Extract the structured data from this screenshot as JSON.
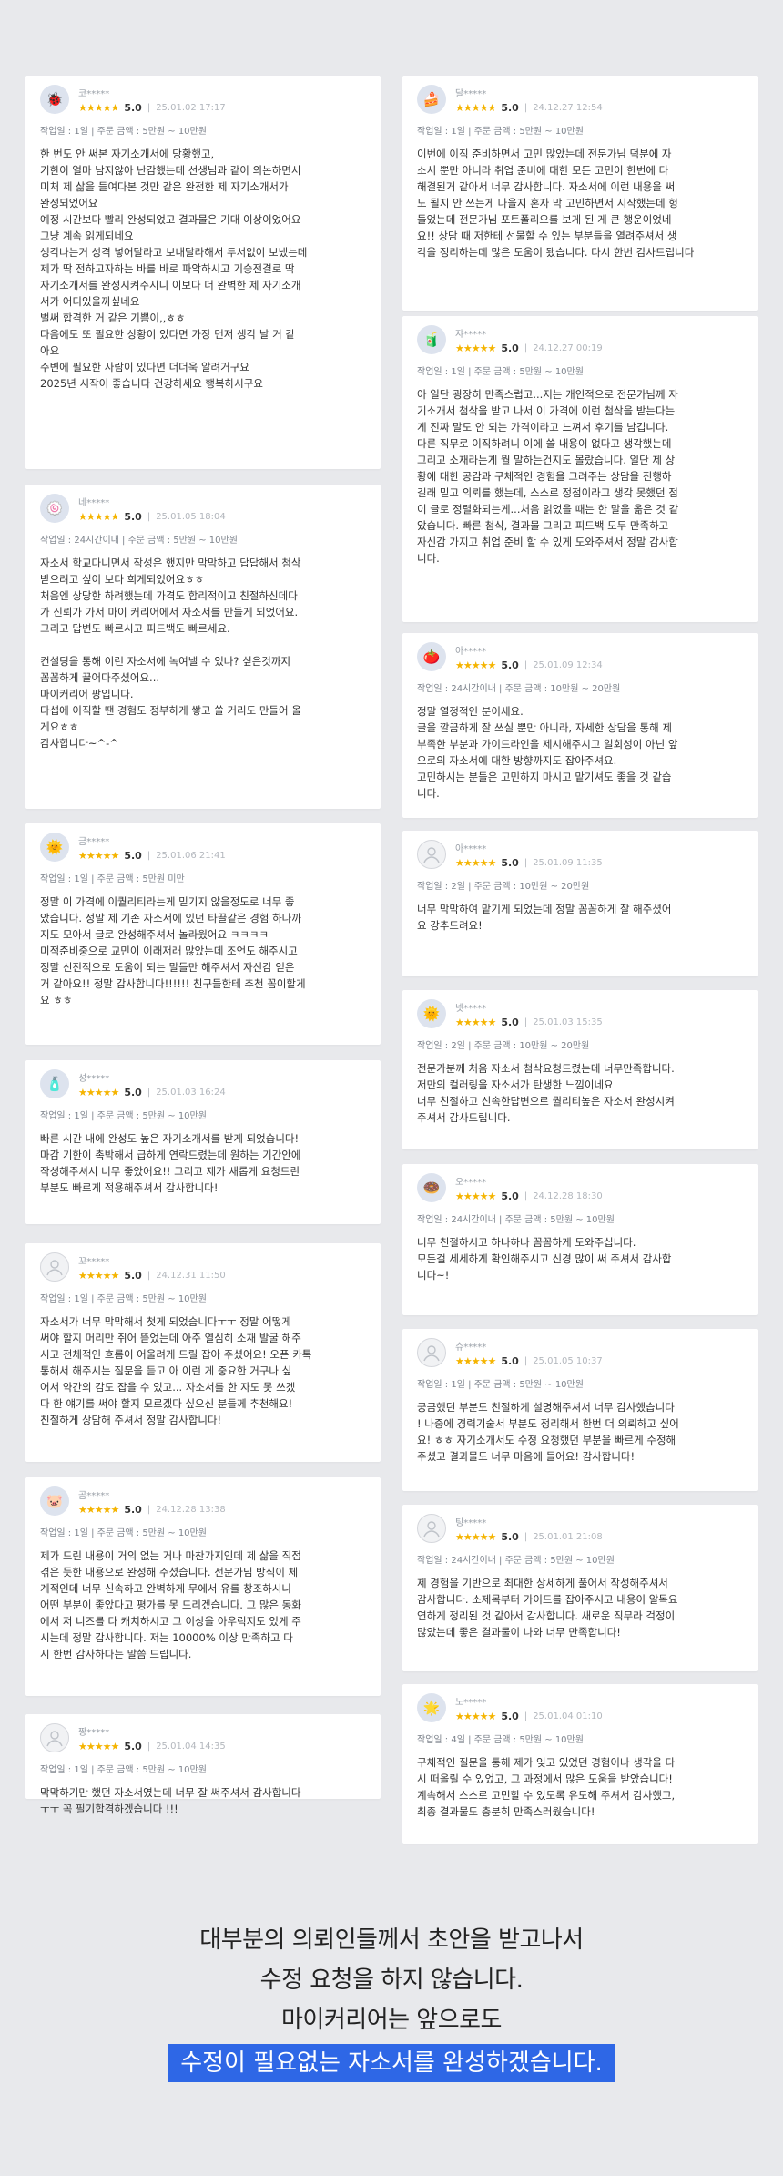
{
  "reviews_left": [
    {
      "avatar": "🐞",
      "name": "코*****",
      "score": "5.0",
      "date": "25.01.02 17:17",
      "tags": "작업일 : 1일 | 주문 금액 : 5만원 ~ 10만원",
      "text": "한 번도 안 써본 자기소개서에 당황했고,\n기한이 얼마 남지않아 난감했는데 선생님과 같이 의논하면서\n 미처 제 삶을 들여다본 것만 같은 완전한 제 자기소개서가\n완성되었어요\n예정 시간보다 빨리 완성되었고 결과물은 기대 이상이었어요\n그냥 계속 읽게되네요\n생각나는거 성격 넣어달라고 보내달라해서 두서없이 보냈는데\n제가 딱 전하고자하는 바를 바로 파악하시고 기승전결로 딱\n자기소개서를 완성시켜주시니 이보다 더 완벽한 제 자기소개\n서가 어디있을까싶네요\n벌써 합격한 거 같은 기쁨이,,ㅎㅎ\n다음에도 또 필요한 상황이 있다면 가장 먼저 생각 날 거 같\n아요\n주변에 필요한 사람이 있다면 더더욱 알려거구요\n2025년 시작이 좋습니다 건강하세요 행복하시구요"
    },
    {
      "avatar": "🍥",
      "name": "네*****",
      "score": "5.0",
      "date": "25.01.05 18:04",
      "tags": "작업일 : 24시간이내 | 주문 금액 : 5만원 ~ 10만원",
      "text": "자소서 학교다니면서 작성은 했지만 막막하고 답답해서 첨삭\n받으려고 싶이 보다 희게되었어요ㅎㅎ\n처음엔 상당한 하려했는데 가격도 합리적이고 친절하신데다\n가 신뢰가 가서 마이 커리어에서 자소서를 만들게 되었어요.\n그리고 답변도 빠르시고 피드백도 빠르세요.\n\n컨설팅을 통해 이런 자소서에 녹여낼 수 있나? 싶은것까지\n꼼꼼하게 끌어다주셨어요...\n마이커리어 팡입니다.\n다섭에 이직할 땐 경험도 정부하게 쌓고 쓸 거리도 만들어 올\n게요ㅎㅎ\n감사합니다~^-^"
    },
    {
      "avatar": "🌞",
      "name": "금*****",
      "score": "5.0",
      "date": "25.01.06 21:41",
      "tags": "작업일 : 1일 | 주문 금액 : 5만원 미만",
      "text": "정말 이 가격에 이퀄리티라는게 믿기지 않을정도로 너무 좋\n았습니다. 정말 제 기존 자소서에 있던 타끌같은 경험 하나까\n지도 모아서 글로 완성해주셔서 놀라웠어요 ㅋㅋㅋㅋ\n미적준비중으로 교민이 이래저래 많았는데 조언도 해주시고\n정말 신진적으로 도움이 되는 말들만 해주셔서 자신감 얻은\n거 같아요!! 정말 감사합니다!!!!!! 친구들한테 추천 꼼이할게\n요 ㅎㅎ"
    },
    {
      "avatar": "🧴",
      "name": "성*****",
      "score": "5.0",
      "date": "25.01.03 16:24",
      "tags": "작업일 : 1일 | 주문 금액 : 5만원 ~ 10만원",
      "text": "빠른 시간 내에 완성도 높은 자기소개서를 받게 되었습니다!\n마감 기한이 촉박해서 급하게 연락드렸는데 원하는 기간안에\n 작성해주셔서 너무 좋았어요!! 그리고 제가 새롭게 요청드린\n 부분도 빠르게 적용해주셔서 감사합니다!"
    },
    {
      "avatar": "",
      "name": "꼬*****",
      "score": "5.0",
      "date": "24.12.31 11:50",
      "tags": "작업일 : 1일 | 주문 금액 : 5만원 ~ 10만원",
      "text": "자소서가 너무 막막해서 첫게 되었습니다ㅜㅜ 정말 어떻게\n써야 할지 머리만 쥐어 뜯었는데 아주 열심히 소재 발굴 해주\n시고 전체적인 흐름이 어울려게 드릴 잡아 주셨어요! 오픈 카톡\n통해서 해주시는 질문을 듣고 아 이런 게 중요한 거구나 싶\n어서 약간의 감도 잡을 수 있고... 자소서를 한 자도 못 쓰겠\n다 한 얘기를 써야 할지 모르겠다 싶으신 분들께 추천해요!\n친절하게 상담해 주셔서 정말 감사합니다!"
    },
    {
      "avatar": "🐷",
      "name": "곰*****",
      "score": "5.0",
      "date": "24.12.28 13:38",
      "tags": "작업일 : 1일 | 주문 금액 : 5만원 ~ 10만원",
      "text": "제가 드린 내용이 거의 없는 거나 마찬가지인데 제 삶을 직접\n 겪은 듯한 내용으로 완성해 주셨습니다. 전문가님 방식이 체\n계적인데 너무 신속하고 완벽하게 무에서 유를 창조하시니\n어떤 부분이 좋았다고 평가를 못 드리겠습니다. 그 많은 동화\n에서 저 니즈를 다 캐치하시고 그 이상을 아우릭지도 있게 주\n시는데 정말 감사합니다. 저는 10000% 이상 만족하고 다\n시 한번 감사하다는 말씀 드립니다."
    },
    {
      "avatar": "",
      "name": "짱*****",
      "score": "5.0",
      "date": "25.01.04 14:35",
      "tags": "작업일 : 1일 | 주문 금액 : 5만원 ~ 10만원",
      "text": "막막하기만 했던 자소서였는데 너무 잘 써주셔서 감사합니다\nㅜㅜ 꼭 필기합격하겠습니다 !!!"
    }
  ],
  "reviews_right": [
    {
      "avatar": "🍰",
      "name": "달*****",
      "score": "5.0",
      "date": "24.12.27 12:54",
      "tags": "작업일 : 1일 | 주문 금액 : 5만원 ~ 10만원",
      "text": "이번에 이직 준비하면서 고민 많았는데 전문가님 덕분에 자\n소서 뿐만 아니라 취업 준비에 대한 모든 고민이 한번에 다\n해결된거 같아서 너무 감사합니다. 자소서에 이런 내용을 써\n도 될지 안 쓰는게 나을지 혼자 막 고민하면서 시작했는데 헝\n들었는데 전문가님 포트폴리오를 보게 된 게 큰 행운이었네\n요!! 상담 때 저한테 선물할 수 있는 부분들을 열려주셔서 생\n각을 정리하는데 많은 도움이 됐습니다. 다시 한번 감사드립니다"
    },
    {
      "avatar": "🧃",
      "name": "쟈*****",
      "score": "5.0",
      "date": "24.12.27 00:19",
      "tags": "작업일 : 1일 | 주문 금액 : 5만원 ~ 10만원",
      "text": "아 일단 굉장히 만족스럽고...저는 개인적으로 전문가님께 자\n기소개서 첨삭을 받고 나서 이 가격에 이런 첨삭을 받는다는\n게 진짜 말도 안 되는 가격이라고 느껴서 후기를 남깁니다.\n 다른 직무로 이직하려니 이에 쓸 내용이 없다고 생각했는데\n그리고 소재라는게 뭘 말하는건지도 몰랐습니다. 일단 제 상\n황에 대한 공감과 구체적인 경험을 그려주는 상담을 진행하\n길래 믿고 의뢰를 했는데, 스스로 정점이라고 생각 못했던 점\n이 글로 정렬화되는게...처음 읽었을 때는 한 말을 옮은 것 같\n았습니다. 빠른 첨식, 결과물 그리고 피드백 모두 만족하고\n자신감 가지고 취업 준비 할 수 있게 도와주셔서 정말 감사합\n니다."
    },
    {
      "avatar": "🍅",
      "name": "아*****",
      "score": "5.0",
      "date": "25.01.09 12:34",
      "tags": "작업일 : 24시간이내 | 주문 금액 : 10만원 ~ 20만원",
      "text": "정말 열정적인 분이세요.\n글을 깔끔하게 잘 쓰실 뿐만 아니라, 자세한 상담을 통해 제\n부족한 부분과 가이드라인을 제시해주시고 일회성이 아닌 앞\n으로의 자소서에 대한 방향까지도 잡아주셔요.\n고민하시는 분들은 고민하지 마시고 맡기셔도 좋을 것 같습\n니다."
    },
    {
      "avatar": "",
      "name": "아*****",
      "score": "5.0",
      "date": "25.01.09 11:35",
      "tags": "작업일 : 2일 | 주문 금액 : 10만원 ~ 20만원",
      "text": "너무 막막하여 맡기게 되었는데 정말 꼼꼼하게 잘 해주셨어\n요 강추드려요!"
    },
    {
      "avatar": "🌞",
      "name": "넷*****",
      "score": "5.0",
      "date": "25.01.03 15:35",
      "tags": "작업일 : 2일 | 주문 금액 : 10만원 ~ 20만원",
      "text": "전문가분께 처음 자소서 첨삭요청드렸는데 너무만족합니다.\n저만의 컬러링을 자소서가 탄생한 느낌이네요\n너무 친절하고 신속한답변으로 퀄리티높은 자소서 완성시켜\n주셔서 감사드립니다."
    },
    {
      "avatar": "🍩",
      "name": "오*****",
      "score": "5.0",
      "date": "24.12.28 18:30",
      "tags": "작업일 : 24시간이내 | 주문 금액 : 5만원 ~ 10만원",
      "text": "너무 친절하시고 하나하나 꼼꼼하게 도와주십니다.\n모든걸 세세하게 확인해주시고 신경 많이 써 주셔서 감사합\n니다~!"
    },
    {
      "avatar": "",
      "name": "슈*****",
      "score": "5.0",
      "date": "25.01.05 10:37",
      "tags": "작업일 : 1일 | 주문 금액 : 5만원 ~ 10만원",
      "text": "궁금했던 부분도 친절하게 설명해주셔서 너무 감사했습니다\n! 나중에 경력기술서 부분도 정리해서 한번 더 의뢰하고 싶어\n요! ㅎㅎ 자기소개서도 수정 요청했던 부분을 빠르게 수정해\n주셨고 결과물도 너무 마음에 들어요! 감사합니다!"
    },
    {
      "avatar": "",
      "name": "팅*****",
      "score": "5.0",
      "date": "25.01.01 21:08",
      "tags": "작업일 : 24시간이내 | 주문 금액 : 5만원 ~ 10만원",
      "text": "제 경험을 기반으로 최대한 상세하게 풀어서 작성해주셔서\n감사합니다. 소제목부터 가이드를 잡아주시고 내용이 알목요\n연하게 정리된 것 같아서 감사합니다. 새로운 직무라 걱정이\n많았는데 좋은 결과물이 나와 너무 만족합니다!"
    },
    {
      "avatar": "🌟",
      "name": "노*****",
      "score": "5.0",
      "date": "25.01.04 01:10",
      "tags": "작업일 : 4일 | 주문 금액 : 5만원 ~ 10만원",
      "text": "구체적인 질문을 통해 제가 잊고 있었던 경험이나 생각을 다\n시 떠올릴 수 있었고, 그 과정에서 많은 도움을 받았습니다!\n계속해서 스스로 고민할 수 있도록 유도해 주셔서 감사했고,\n최종 결과물도 충분히 만족스러웠습니다!"
    }
  ],
  "footer": {
    "line1": "대부분의 의뢰인들께서 초안을 받고나서",
    "line2": "수정 요청을 하지 않습니다.",
    "line3": "마이커리어는 앞으로도",
    "highlight": "수정이 필요없는 자소서를 완성하겠습니다."
  },
  "colors": {
    "star": "#f5b400",
    "accent": "#2e67e6",
    "background": "#e8e9ec"
  }
}
